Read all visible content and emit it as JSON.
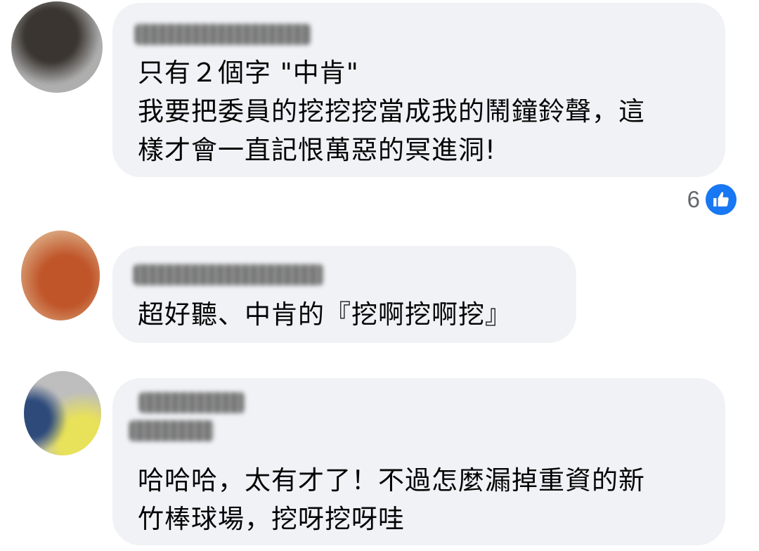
{
  "comments": [
    {
      "lines": [
        "只有２個字 \"中肯\"",
        "我要把委員的挖挖挖當成我的鬧鐘鈴聲，這",
        "樣才會一直記恨萬惡的冥進洞!"
      ],
      "reactions": {
        "count": "6",
        "icon": "like-icon",
        "color": "#1877f2"
      }
    },
    {
      "lines": [
        "超好聽、中肯的『挖啊挖啊挖』"
      ]
    },
    {
      "lines": [
        "哈哈哈，太有才了！不過怎麼漏掉重資的新",
        "竹棒球場，挖呀挖呀哇"
      ]
    }
  ],
  "colors": {
    "bubble_bg": "#f0f2f5",
    "text": "#050505",
    "reaction_count": "#65676b",
    "like_blue": "#1877f2"
  }
}
